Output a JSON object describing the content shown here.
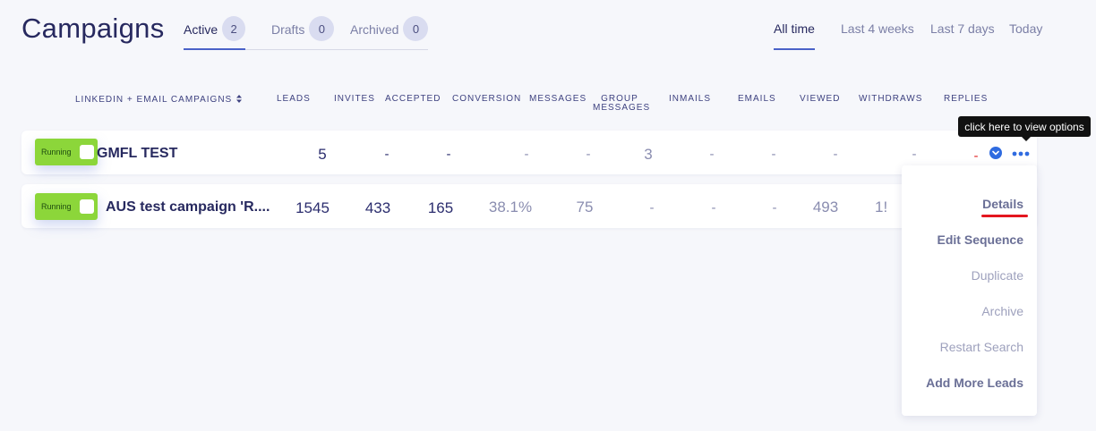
{
  "page_title": "Campaigns",
  "status_tabs": [
    {
      "label": "Active",
      "count": "2"
    },
    {
      "label": "Drafts",
      "count": "0"
    },
    {
      "label": "Archived",
      "count": "0"
    }
  ],
  "time_filters": [
    "All time",
    "Last 4 weeks",
    "Last 7 days",
    "Today"
  ],
  "columns": {
    "campaign": "LINKEDIN + EMAIL CAMPAIGNS",
    "leads": "LEADS",
    "invites": "INVITES",
    "accepted": "ACCEPTED",
    "conversion": "CONVERSION",
    "messages": "MESSAGES",
    "group_messages_1": "GROUP",
    "group_messages_2": "MESSAGES",
    "inmails": "INMAILS",
    "emails": "EMAILS",
    "viewed": "VIEWED",
    "withdraws": "WITHDRAWS",
    "replies": "REPLIES"
  },
  "sort_icon": "sort-arrows-icon",
  "rows": [
    {
      "status": "Running",
      "name": "GMFL TEST",
      "leads": "5",
      "invites": "-",
      "accepted": "-",
      "conversion": "-",
      "messages": "-",
      "group_messages": "3",
      "inmails": "-",
      "emails": "-",
      "viewed": "-",
      "withdraws": "-",
      "replies": "-"
    },
    {
      "status": "Running",
      "name": "AUS test campaign 'R....",
      "leads": "1545",
      "invites": "433",
      "accepted": "165",
      "conversion": "38.1%",
      "messages": "75",
      "group_messages": "-",
      "inmails": "-",
      "emails": "-",
      "viewed": "493",
      "withdraws": "1!"
    }
  ],
  "tooltip": "click here to view options",
  "menu": [
    "Details",
    "Edit Sequence",
    "Duplicate",
    "Archive",
    "Restart Search",
    "Add More Leads"
  ],
  "colors": {
    "accent": "#4a62c8",
    "running": "#8cd63a",
    "replies_dash": "#e02424",
    "menu_underline": "#e4161f"
  }
}
